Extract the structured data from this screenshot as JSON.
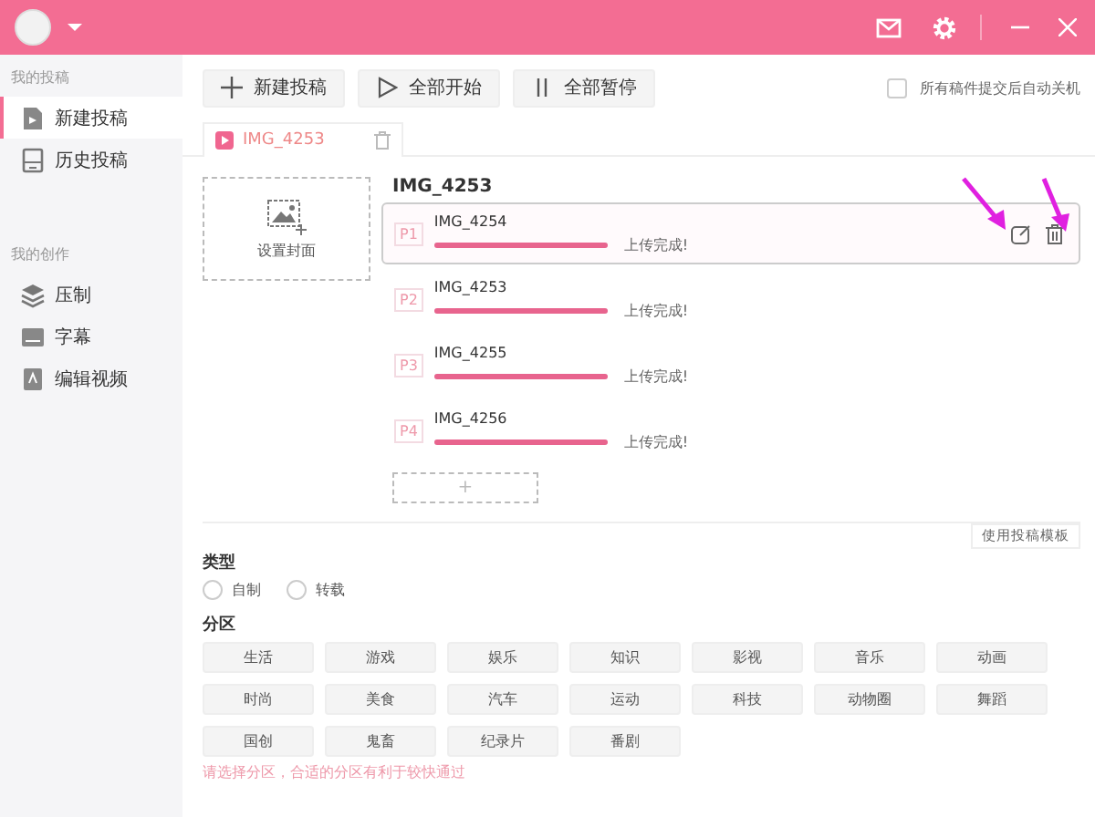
{
  "sidebar": {
    "sections": [
      {
        "label": "我的投稿",
        "items": [
          {
            "label": "新建投稿",
            "selected": true
          },
          {
            "label": "历史投稿",
            "selected": false
          }
        ]
      },
      {
        "label": "我的创作",
        "items": [
          {
            "label": "压制",
            "selected": false
          },
          {
            "label": "字幕",
            "selected": false
          },
          {
            "label": "编辑视频",
            "selected": false
          }
        ]
      }
    ]
  },
  "toolbar": {
    "buttons": [
      {
        "label": "新建投稿"
      },
      {
        "label": "全部开始"
      },
      {
        "label": "全部暂停"
      }
    ],
    "auto_shutdown": {
      "label": "所有稿件提交后自动关机",
      "checked": false
    }
  },
  "tabs": [
    {
      "label": "IMG_4253"
    }
  ],
  "cover": {
    "label": "设置封面"
  },
  "video_title": "IMG_4253",
  "parts": [
    {
      "index": "P1",
      "name": "IMG_4254",
      "level": 1,
      "status": "上传完成!",
      "selected": true
    },
    {
      "index": "P2",
      "name": "IMG_4253",
      "level": 1,
      "status": "上传完成!",
      "selected": false
    },
    {
      "index": "P3",
      "name": "IMG_4255",
      "level": 1,
      "status": "上传完成!",
      "selected": false
    },
    {
      "index": "P4",
      "name": "IMG_4256",
      "level": 1,
      "status": "上传完成!",
      "selected": false
    }
  ],
  "add_part": "+",
  "template_button": "使用投稿模板",
  "type": {
    "label": "类型",
    "options": [
      {
        "label": "自制",
        "selected": false
      },
      {
        "label": "转载",
        "selected": false
      }
    ]
  },
  "category": {
    "label": "分区",
    "rows": [
      [
        "生活",
        "游戏",
        "娱乐",
        "知识",
        "影视",
        "音乐",
        "动画"
      ],
      [
        "时尚",
        "美食",
        "汽车",
        "运动",
        "科技",
        "动物圈",
        "舞蹈"
      ],
      [
        "国创",
        "鬼畜",
        "纪录片",
        "番剧"
      ]
    ],
    "hint": "请选择分区，合适的分区有利于较快通过"
  }
}
